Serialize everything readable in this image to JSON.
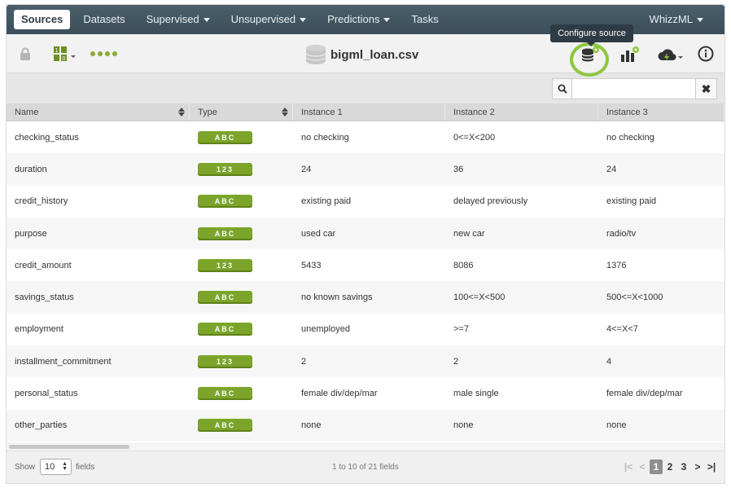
{
  "nav": {
    "items": [
      {
        "label": "Sources",
        "caret": false
      },
      {
        "label": "Datasets",
        "caret": false
      },
      {
        "label": "Supervised",
        "caret": true
      },
      {
        "label": "Unsupervised",
        "caret": true
      },
      {
        "label": "Predictions",
        "caret": true
      },
      {
        "label": "Tasks",
        "caret": false
      }
    ],
    "active": "Sources",
    "right_menu": "WhizzML"
  },
  "toolbar": {
    "title": "bigml_loan.csv",
    "tooltip": "Configure source",
    "icons": [
      "lock-icon",
      "source-type-icon",
      "progress-dots-icon",
      "configure-source-icon",
      "dataset-chart-icon",
      "cloud-actions-icon",
      "info-icon"
    ]
  },
  "search": {
    "placeholder": "",
    "value": ""
  },
  "table": {
    "headers": [
      "Name",
      "Type",
      "Instance 1",
      "Instance 2",
      "Instance 3"
    ],
    "rows": [
      {
        "name": "checking_status",
        "type": "ABC",
        "i1": "no checking",
        "i2": "0<=X<200",
        "i3": "no checking"
      },
      {
        "name": "duration",
        "type": "123",
        "i1": "24",
        "i2": "36",
        "i3": "24"
      },
      {
        "name": "credit_history",
        "type": "ABC",
        "i1": "existing paid",
        "i2": "delayed previously",
        "i3": "existing paid"
      },
      {
        "name": "purpose",
        "type": "ABC",
        "i1": "used car",
        "i2": "new car",
        "i3": "radio/tv"
      },
      {
        "name": "credit_amount",
        "type": "123",
        "i1": "5433",
        "i2": "8086",
        "i3": "1376"
      },
      {
        "name": "savings_status",
        "type": "ABC",
        "i1": "no known savings",
        "i2": "100<=X<500",
        "i3": "500<=X<1000"
      },
      {
        "name": "employment",
        "type": "ABC",
        "i1": "unemployed",
        "i2": ">=7",
        "i3": "4<=X<7"
      },
      {
        "name": "installment_commitment",
        "type": "123",
        "i1": "2",
        "i2": "2",
        "i3": "4"
      },
      {
        "name": "personal_status",
        "type": "ABC",
        "i1": "female div/dep/mar",
        "i2": "male single",
        "i3": "female div/dep/mar"
      },
      {
        "name": "other_parties",
        "type": "ABC",
        "i1": "none",
        "i2": "none",
        "i3": "none"
      }
    ]
  },
  "footer": {
    "show_label": "Show",
    "page_size": "10",
    "fields_label": "fields",
    "range_text": "1 to 10 of 21 fields",
    "pages": [
      "1",
      "2",
      "3"
    ],
    "current_page": "1"
  },
  "colors": {
    "accent": "#7ba52a",
    "highlight_ring": "#8ec63f",
    "nav_bg": "#3f535e"
  }
}
